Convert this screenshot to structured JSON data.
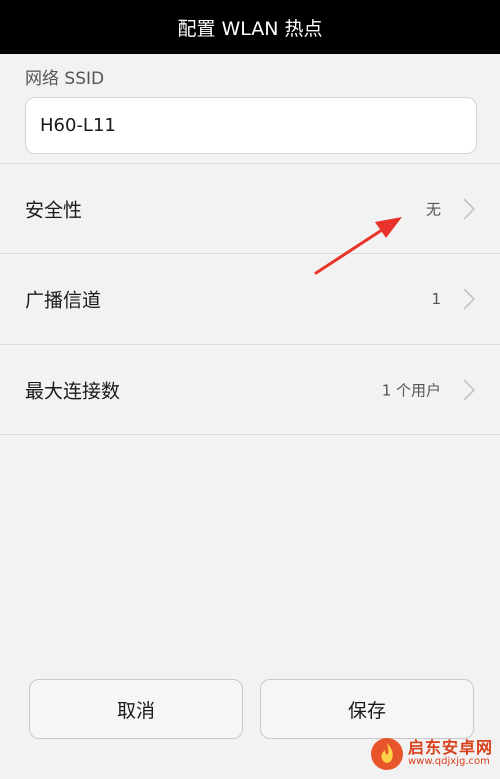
{
  "title": "配置 WLAN 热点",
  "ssid": {
    "label": "网络 SSID",
    "value": "H60-L11"
  },
  "rows": [
    {
      "label": "安全性",
      "value": "无"
    },
    {
      "label": "广播信道",
      "value": "1"
    },
    {
      "label": "最大连接数",
      "value": "1 个用户"
    }
  ],
  "buttons": {
    "cancel": "取消",
    "save": "保存"
  },
  "annotation": {
    "arrow_color": "#e8332b"
  },
  "watermark": {
    "name": "启东安卓网",
    "url": "www.qdjxjg.com",
    "color": "#d8401c"
  },
  "icons": {
    "row_chevron": "chevron-right-icon",
    "watermark_logo": "flame-logo-icon"
  }
}
